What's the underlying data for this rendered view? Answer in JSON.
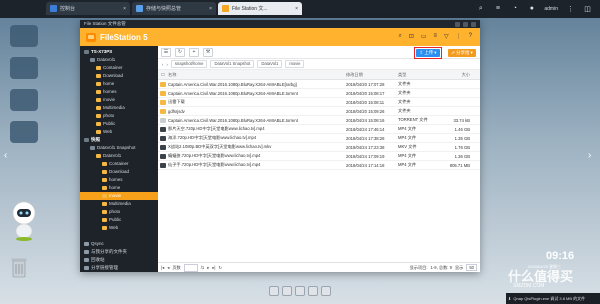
{
  "browser": {
    "tabs": [
      {
        "label": "控制台",
        "color": "#3b7dd8"
      },
      {
        "label": "存储与快照总管",
        "color": "#5aa0e8"
      },
      {
        "label": "File Station 文...",
        "color": "#f5a623"
      }
    ],
    "user": "admin"
  },
  "window": {
    "title": "File Station 文件总管",
    "app_name": "FileStation 5"
  },
  "sidebar": {
    "nodes": [
      {
        "label": "TS-X73PS",
        "level": 0,
        "header": true
      },
      {
        "label": "DataVol1",
        "level": 1
      },
      {
        "label": "Container",
        "level": 2
      },
      {
        "label": "Download",
        "level": 2
      },
      {
        "label": "home",
        "level": 2
      },
      {
        "label": "homes",
        "level": 2
      },
      {
        "label": "movie",
        "level": 2
      },
      {
        "label": "Multimedia",
        "level": 2
      },
      {
        "label": "photo",
        "level": 2
      },
      {
        "label": "Public",
        "level": 2
      },
      {
        "label": "Web",
        "level": 2
      },
      {
        "label": "快照",
        "level": 0,
        "header": true
      },
      {
        "label": "DataVol1 Snapshot",
        "level": 1
      },
      {
        "label": "DataVol1",
        "level": 2
      },
      {
        "label": "Container",
        "level": 3
      },
      {
        "label": "Download",
        "level": 3
      },
      {
        "label": "homes",
        "level": 3
      },
      {
        "label": "home",
        "level": 3
      },
      {
        "label": "movie",
        "level": 3,
        "selected": true
      },
      {
        "label": "Multimedia",
        "level": 3
      },
      {
        "label": "photo",
        "level": 3
      },
      {
        "label": "Public",
        "level": 3
      },
      {
        "label": "Web",
        "level": 3
      }
    ],
    "bottom": [
      {
        "label": "Qsync"
      },
      {
        "label": "与我分享的文件夹"
      },
      {
        "label": "回收站"
      },
      {
        "label": "分享链接管理"
      }
    ]
  },
  "toolbar": {
    "upload_label": "上传",
    "share_label": "分享给",
    "accent_upload": "#2a8ff0",
    "accent_share": "#f39b1d"
  },
  "path": {
    "crumbs": [
      "snapshot/home",
      "DataVol1 Snapshot",
      "DataVol1",
      "movie"
    ]
  },
  "table": {
    "headers": [
      "名称",
      "修改日期",
      "类型",
      "大小"
    ],
    "rows": [
      {
        "icon": "folder",
        "name": "Captain.America.Civil.War.2016.1080p.BluRay.X264-AMIABLE[rarbg]",
        "date": "2018/04/20 17:07:28",
        "type": "文件夹",
        "size": ""
      },
      {
        "icon": "folder",
        "name": "Captain.America.Civil.War.2016.1080p.BluRay.X264-AMIABLE.torrent",
        "date": "2018/04/20 15:08:17",
        "type": "文件夹",
        "size": ""
      },
      {
        "icon": "folder",
        "name": "迅雷下载",
        "date": "2018/04/20 15:08:11",
        "type": "文件夹",
        "size": ""
      },
      {
        "icon": "folder",
        "name": "gdfsrjsdv",
        "date": "2018/04/20 15:09:26",
        "type": "文件夹",
        "size": ""
      },
      {
        "icon": "doc",
        "name": "Captain.America.Civil.War.2016.1080p.BluRay.X264-AMIABLE.torrent",
        "date": "2018/04/24 15:08:16",
        "type": "TORRENT 文件",
        "size": "33.74 kB"
      },
      {
        "icon": "video",
        "name": "那片天空.720p.HD中字[天堂电影www.lichao.tv].mp4",
        "date": "2018/04/24 17:46:14",
        "type": "MP4 文件",
        "size": "1.46 GB"
      },
      {
        "icon": "video",
        "name": "海洋.720p.HD中字[天堂电影www.lichao.tv].mp4",
        "date": "2018/04/24 17:38:28",
        "type": "MP4 文件",
        "size": "1.35 GB"
      },
      {
        "icon": "video",
        "name": "X战站2.1080p.BD中英双字[天堂电影www.lichao.tv].mkv",
        "date": "2018/04/24 17:23:38",
        "type": "MKV 文件",
        "size": "1.76 GB"
      },
      {
        "icon": "video",
        "name": "蝙蝠侠.720p.HD中字[天堂电影www.lichao.tv].mp4",
        "date": "2018/04/24 17:09:19",
        "type": "MP4 文件",
        "size": "1.36 GB"
      },
      {
        "icon": "video",
        "name": "仙子手.720p.HD中字[天堂电影www.lichao.tv].mp4",
        "date": "2018/04/24 17:14:18",
        "type": "MP4 文件",
        "size": "805.71 MB"
      }
    ]
  },
  "status": {
    "page_label": "页数",
    "page_total": "/1",
    "display_label": "显示项目:",
    "range": "1-9, 总数: 9",
    "per_page_label": "显示",
    "per_page": "50"
  },
  "desktop": {
    "time": "09:16",
    "date": "2018/04/25 星期三",
    "watermark": "什么值得买",
    "watermark_sub": "SMZDM.COM",
    "download_bar": "Qnap QtsPlugin.exe 调试 3.8 MB 的文件"
  }
}
